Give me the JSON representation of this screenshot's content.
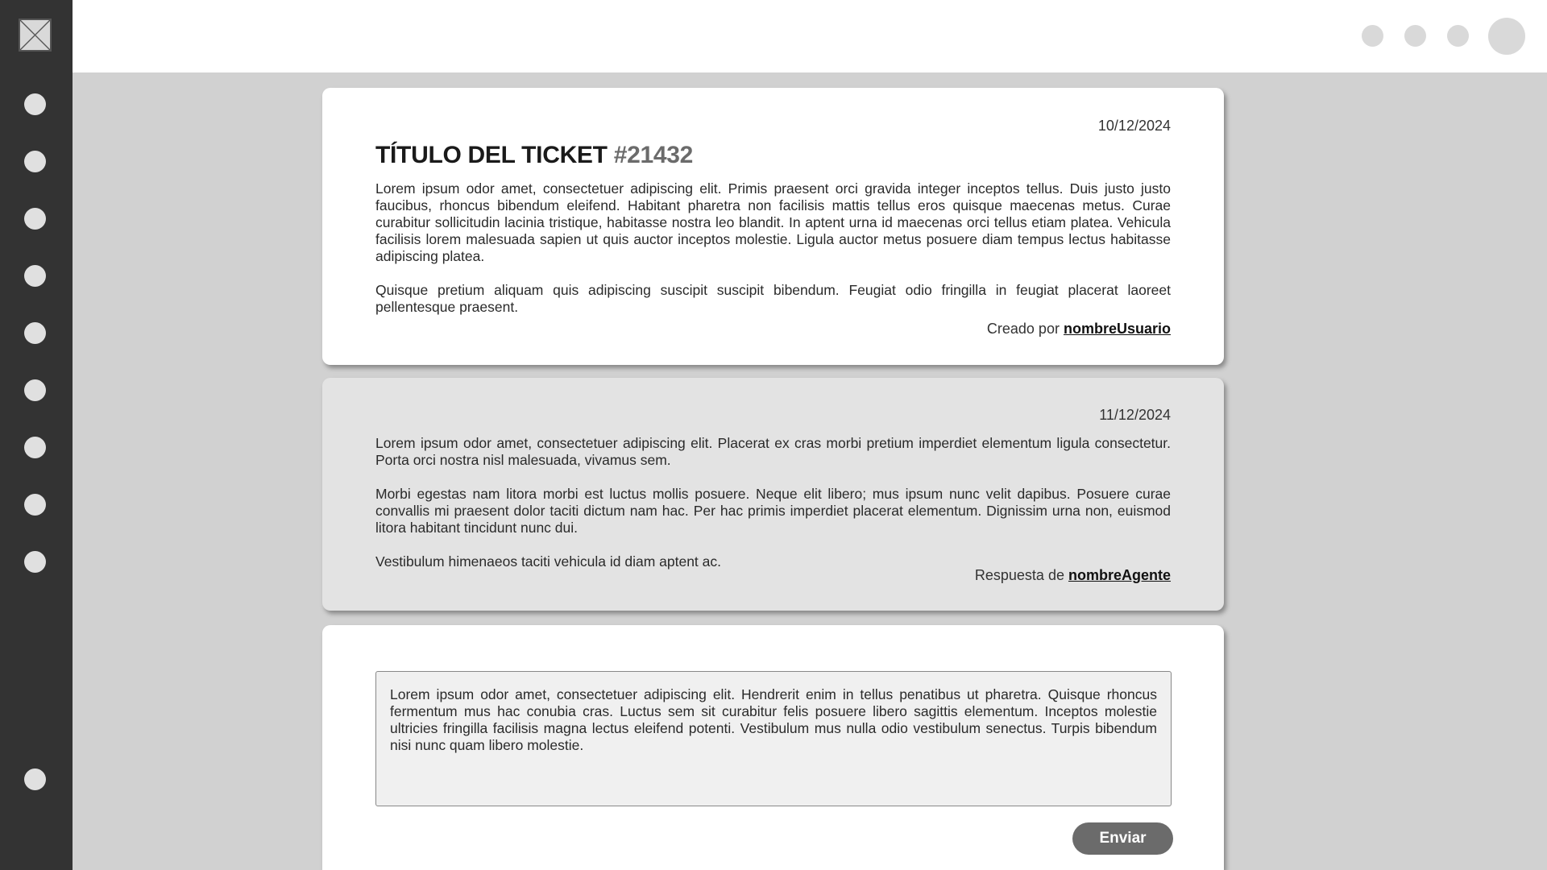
{
  "sidebar": {
    "logo_icon": "placeholder-image-icon",
    "nav_items": [
      "nav-1",
      "nav-2",
      "nav-3",
      "nav-4",
      "nav-5",
      "nav-6",
      "nav-7",
      "nav-8",
      "nav-9"
    ],
    "bottom_item": "nav-bottom"
  },
  "ticket": {
    "date": "10/12/2024",
    "title": "TÍTULO DEL TICKET",
    "number": "#21432",
    "paragraphs": [
      "Lorem ipsum odor amet, consectetuer adipiscing elit. Primis praesent orci gravida integer inceptos tellus. Duis justo justo faucibus, rhoncus bibendum eleifend. Habitant pharetra non facilisis mattis tellus eros quisque maecenas metus. Curae curabitur sollicitudin lacinia tristique, habitasse nostra leo blandit. In aptent urna id maecenas orci tellus etiam platea. Vehicula facilisis lorem malesuada sapien ut quis auctor inceptos molestie. Ligula auctor metus posuere diam tempus lectus habitasse adipiscing platea.",
      "Quisque pretium aliquam quis adipiscing suscipit suscipit bibendum. Feugiat odio fringilla in feugiat placerat laoreet pellentesque praesent."
    ],
    "created_by_label": "Creado por",
    "created_by_user": "nombreUsuario"
  },
  "response": {
    "date": "11/12/2024",
    "paragraphs": [
      "Lorem ipsum odor amet, consectetuer adipiscing elit. Placerat ex cras morbi pretium imperdiet elementum ligula consectetur. Porta orci nostra nisl malesuada, vivamus sem.",
      "Morbi egestas nam litora morbi est luctus mollis posuere. Neque elit libero; mus ipsum nunc velit dapibus. Posuere curae convallis mi praesent dolor taciti dictum nam hac. Per hac primis imperdiet placerat elementum. Dignissim urna non, euismod litora habitant tincidunt nunc dui.",
      "Vestibulum himenaeos taciti vehicula id diam aptent ac."
    ],
    "response_by_label": "Respuesta de",
    "response_by_agent": "nombreAgente"
  },
  "reply": {
    "text": "Lorem ipsum odor amet, consectetuer adipiscing elit. Hendrerit enim in tellus penatibus ut pharetra. Quisque rhoncus fermentum mus hac conubia cras. Luctus sem sit curabitur felis posuere libero sagittis elementum. Inceptos molestie ultricies fringilla facilisis magna lectus eleifend potenti. Vestibulum mus nulla odio vestibulum senectus. Turpis bibendum nisi nunc quam libero molestie.",
    "send_label": "Enviar"
  },
  "colors": {
    "sidebar_bg": "#333333",
    "page_bg": "#d1d1d1",
    "button_bg": "#6b6b6b"
  }
}
